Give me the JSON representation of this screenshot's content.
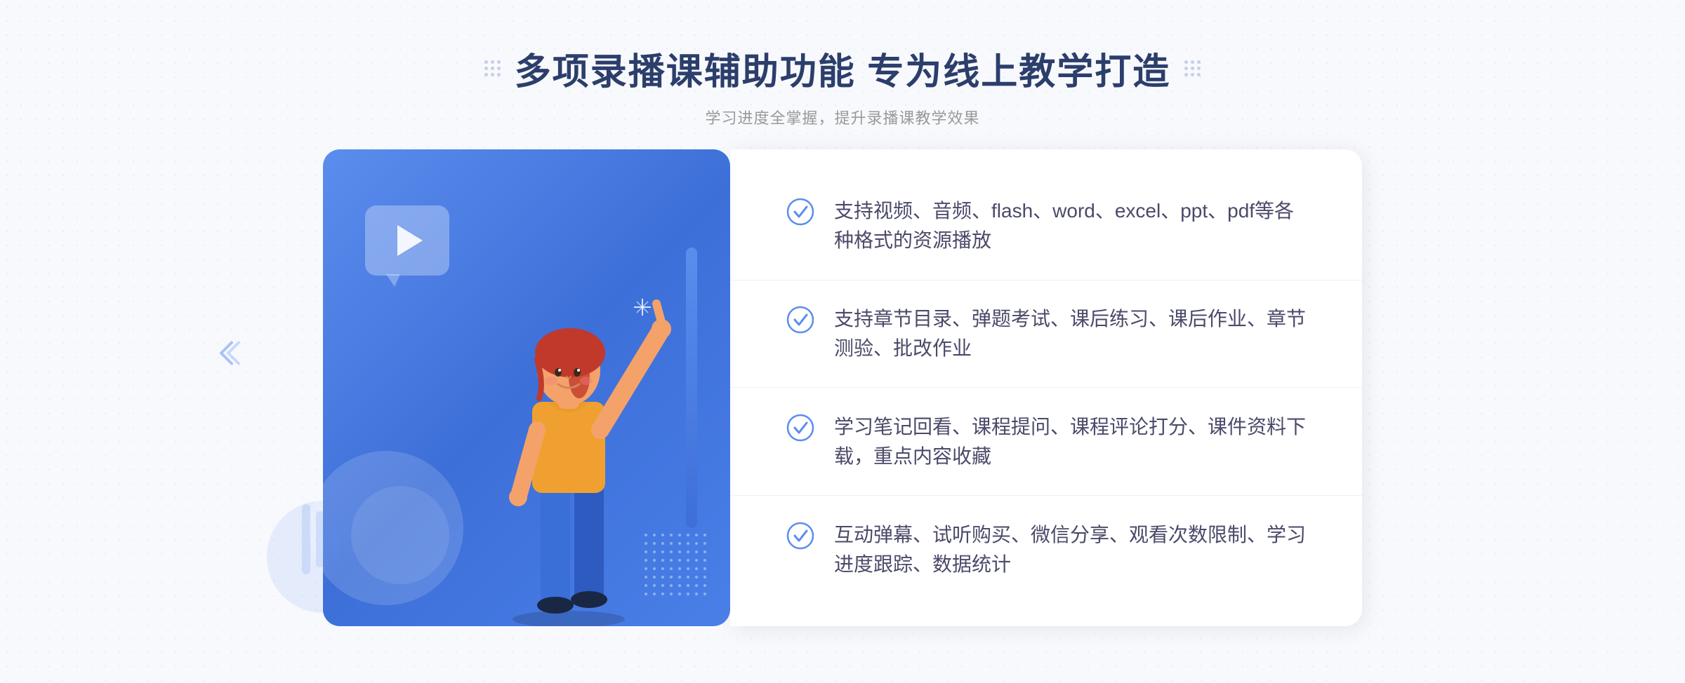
{
  "header": {
    "title": "多项录播课辅助功能 专为线上教学打造",
    "subtitle": "学习进度全掌握，提升录播课教学效果"
  },
  "features": [
    {
      "id": 1,
      "text": "支持视频、音频、flash、word、excel、ppt、pdf等各种格式的资源播放"
    },
    {
      "id": 2,
      "text": "支持章节目录、弹题考试、课后练习、课后作业、章节测验、批改作业"
    },
    {
      "id": 3,
      "text": "学习笔记回看、课程提问、课程评论打分、课件资料下载，重点内容收藏"
    },
    {
      "id": 4,
      "text": "互动弹幕、试听购买、微信分享、观看次数限制、学习进度跟踪、数据统计"
    }
  ],
  "colors": {
    "accent": "#5b8dee",
    "title": "#2c3e6b",
    "subtitle": "#999999",
    "feature_text": "#4a4a6a",
    "check_color": "#5b8dee"
  }
}
